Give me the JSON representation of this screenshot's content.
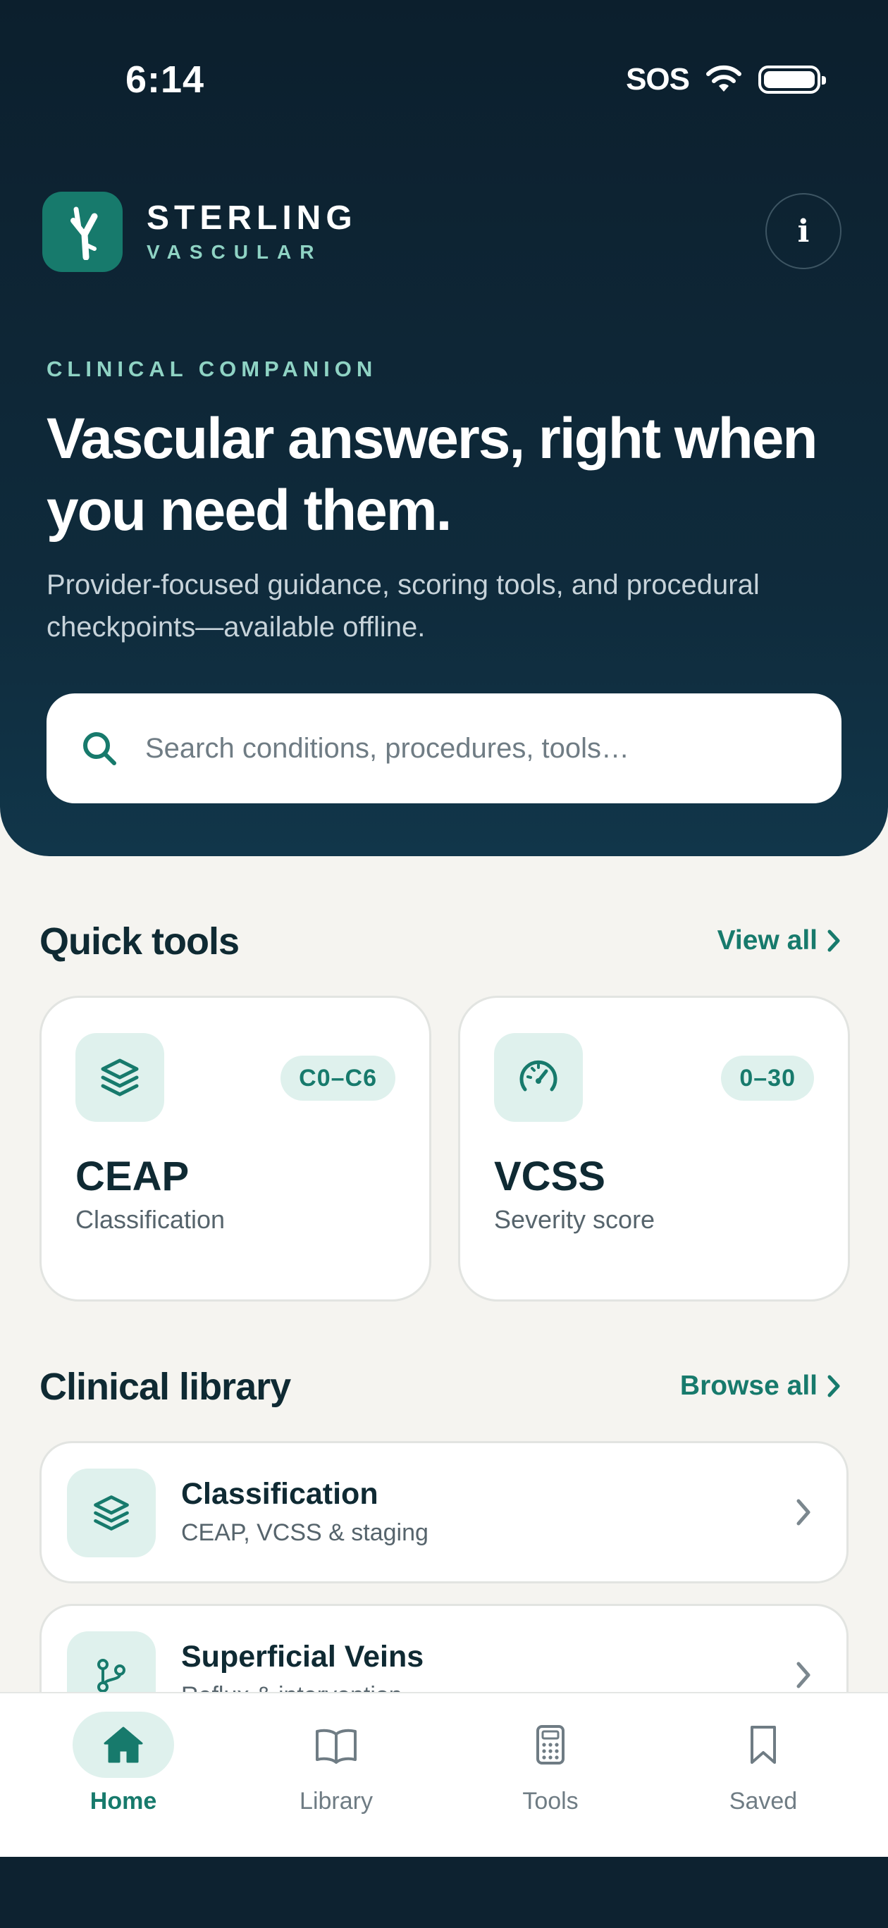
{
  "status_bar": {
    "time": "6:14",
    "carrier": "SOS"
  },
  "brand": {
    "name": "STERLING",
    "sub": "VASCULAR",
    "info_label": "i"
  },
  "hero": {
    "eyebrow": "CLINICAL COMPANION",
    "headline": "Vascular answers, right when you need them.",
    "subhead": "Provider-focused guidance, scoring tools, and procedural checkpoints—available offline."
  },
  "search": {
    "placeholder": "Search conditions, procedures, tools…"
  },
  "quick_tools": {
    "title": "Quick tools",
    "link": "View all",
    "items": [
      {
        "name": "CEAP",
        "desc": "Classification",
        "badge": "C0–C6",
        "icon": "layers-icon"
      },
      {
        "name": "VCSS",
        "desc": "Severity score",
        "badge": "0–30",
        "icon": "gauge-icon"
      }
    ]
  },
  "library": {
    "title": "Clinical library",
    "link": "Browse all",
    "items": [
      {
        "title": "Classification",
        "sub": "CEAP, VCSS & staging",
        "icon": "layers-icon"
      },
      {
        "title": "Superficial Veins",
        "sub": "Reflux & intervention",
        "icon": "branch-icon"
      }
    ]
  },
  "nav": {
    "items": [
      {
        "label": "Home",
        "icon": "home-icon",
        "active": true
      },
      {
        "label": "Library",
        "icon": "book-icon",
        "active": false
      },
      {
        "label": "Tools",
        "icon": "calculator-icon",
        "active": false
      },
      {
        "label": "Saved",
        "icon": "bookmark-icon",
        "active": false
      }
    ]
  },
  "colors": {
    "accent": "#177a6c",
    "hero": "#0f2b3c",
    "mint": "#8fd3c4",
    "tint": "#dff1ed"
  }
}
